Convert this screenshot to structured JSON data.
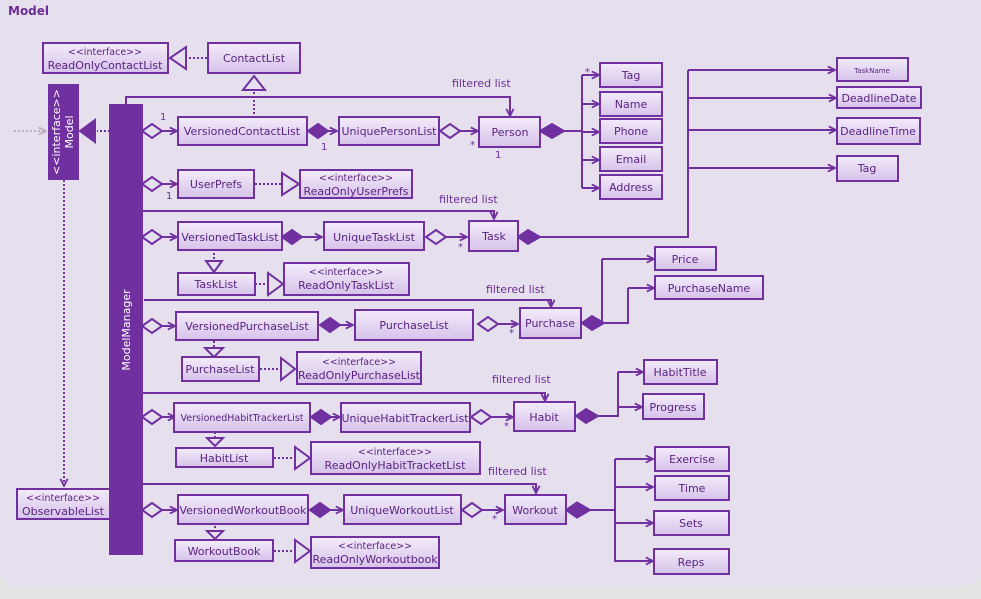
{
  "diagram": {
    "title": "Model",
    "stereotype": "<<interface>>",
    "association_label": "filtered list",
    "model_interface": {
      "stereotype": "<<interface>>",
      "name": "Model"
    },
    "model_manager": {
      "name": "ModelManager"
    },
    "observable_list": {
      "stereotype": "<<interface>>",
      "name": "ObservableList"
    },
    "contact": {
      "read_only": {
        "stereotype": "<<interface>>",
        "name": "ReadOnlyContactList"
      },
      "list": "ContactList",
      "versioned": "VersionedContactList",
      "unique": "UniquePersonList",
      "entity": "Person",
      "mult_versioned": "1",
      "mult_unique": "1",
      "mult_entity_many": "*",
      "mult_entity_one": "1",
      "attributes": [
        "Tag",
        "Name",
        "Phone",
        "Email",
        "Address"
      ]
    },
    "userprefs": {
      "name": "UserPrefs",
      "read_only": {
        "stereotype": "<<interface>>",
        "name": "ReadOnlyUserPrefs"
      },
      "mult": "1"
    },
    "task": {
      "versioned": "VersionedTaskList",
      "unique": "UniqueTaskList",
      "entity": "Task",
      "list": "TaskList",
      "read_only": {
        "stereotype": "<<interface>>",
        "name": "ReadOnlyTaskList"
      },
      "mult_entity_many": "*",
      "attributes": [
        "TaskName",
        "DeadlineDate",
        "DeadlineTime",
        "Tag"
      ]
    },
    "purchase": {
      "versioned": "VersionedPurchaseList",
      "unique": "PurchaseList",
      "entity": "Purchase",
      "list": "PurchaseList",
      "read_only": {
        "stereotype": "<<interface>>",
        "name": "ReadOnlyPurchaseList"
      },
      "mult_entity_many": "*",
      "attributes": [
        "Price",
        "PurchaseName"
      ]
    },
    "habit": {
      "versioned": "VersionedHabitTrackerList",
      "unique": "UniqueHabitTrackerList",
      "entity": "Habit",
      "list": "HabitList",
      "read_only": {
        "stereotype": "<<interface>>",
        "name": "ReadOnlyHabitTracketList"
      },
      "mult_entity_many": "*",
      "attributes": [
        "HabitTitle",
        "Progress"
      ]
    },
    "workout": {
      "versioned": "VersionedWorkoutBook",
      "unique": "UniqueWorkoutList",
      "entity": "Workout",
      "list": "WorkoutBook",
      "read_only": {
        "stereotype": "<<interface>>",
        "name": "ReadOnlyWorkoutbook"
      },
      "mult_entity_many": "*",
      "attributes": [
        "Exercise",
        "Time",
        "Sets",
        "Reps"
      ]
    }
  }
}
